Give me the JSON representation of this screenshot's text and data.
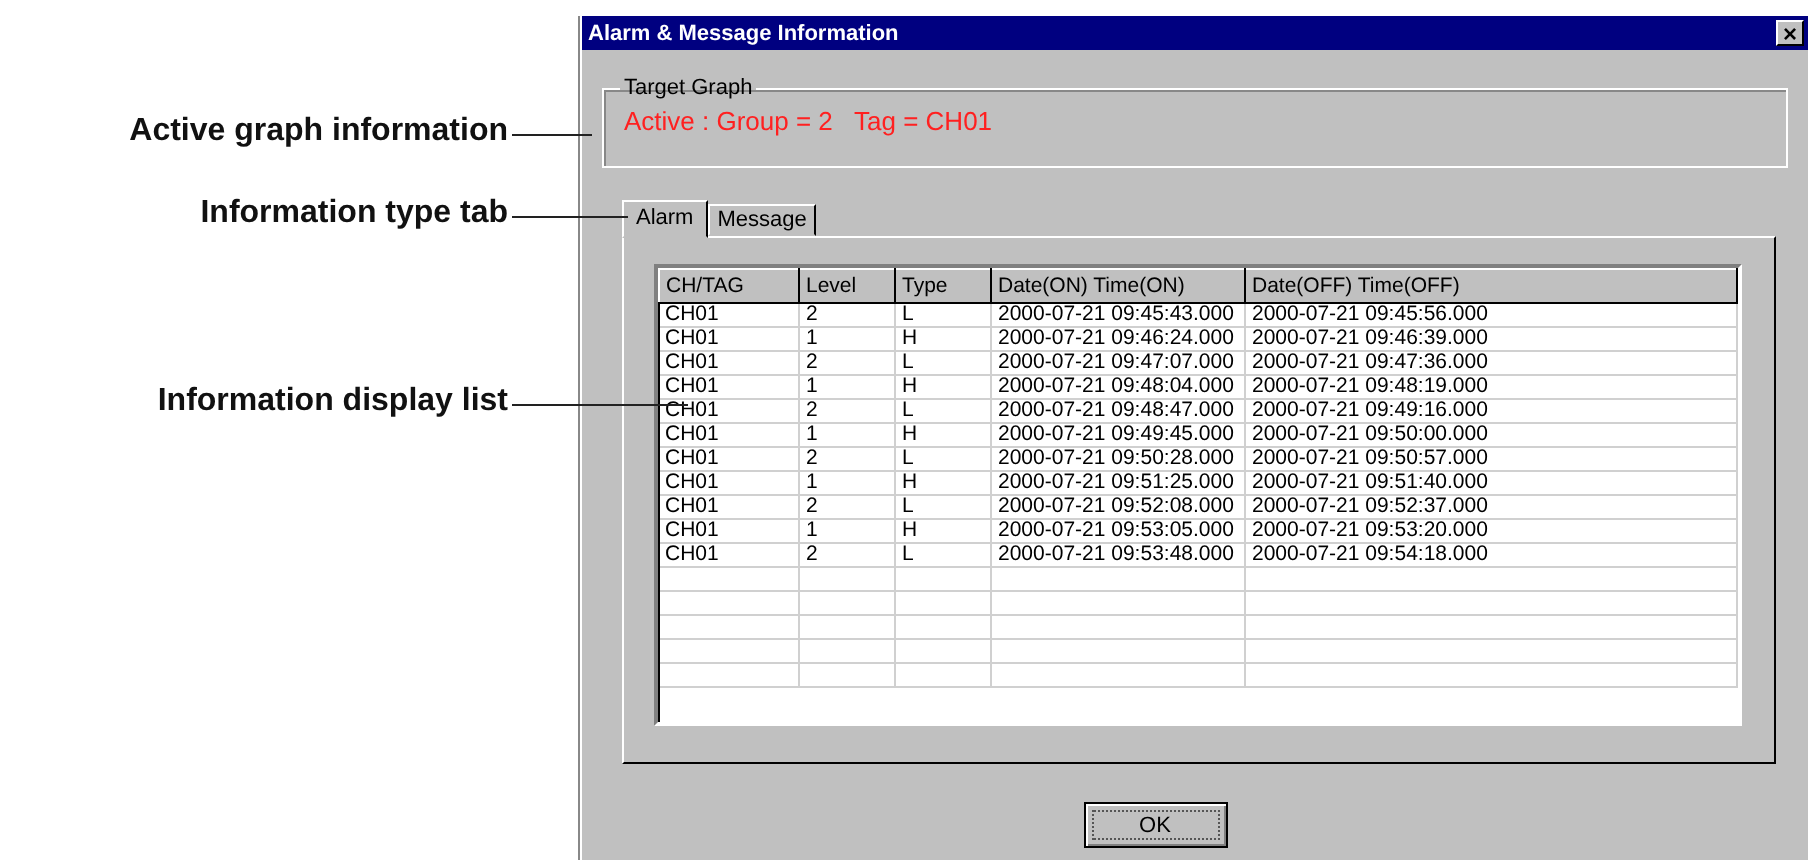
{
  "callouts": [
    {
      "label": "Active graph information"
    },
    {
      "label": "Information type tab"
    },
    {
      "label": "Information display list"
    }
  ],
  "window": {
    "title": "Alarm & Message Information",
    "close": "×"
  },
  "target_graph": {
    "legend": "Target Graph",
    "text": "Active : Group = 2   Tag = CH01"
  },
  "tabs": [
    {
      "label": "Alarm",
      "selected": true
    },
    {
      "label": "Message",
      "selected": false
    }
  ],
  "table": {
    "columns": [
      "CH/TAG",
      "Level",
      "Type",
      "Date(ON) Time(ON)",
      "Date(OFF) Time(OFF)"
    ],
    "rows": [
      [
        "CH01",
        "2",
        "L",
        "2000-07-21 09:45:43.000",
        "2000-07-21 09:45:56.000"
      ],
      [
        "CH01",
        "1",
        "H",
        "2000-07-21 09:46:24.000",
        "2000-07-21 09:46:39.000"
      ],
      [
        "CH01",
        "2",
        "L",
        "2000-07-21 09:47:07.000",
        "2000-07-21 09:47:36.000"
      ],
      [
        "CH01",
        "1",
        "H",
        "2000-07-21 09:48:04.000",
        "2000-07-21 09:48:19.000"
      ],
      [
        "CH01",
        "2",
        "L",
        "2000-07-21 09:48:47.000",
        "2000-07-21 09:49:16.000"
      ],
      [
        "CH01",
        "1",
        "H",
        "2000-07-21 09:49:45.000",
        "2000-07-21 09:50:00.000"
      ],
      [
        "CH01",
        "2",
        "L",
        "2000-07-21 09:50:28.000",
        "2000-07-21 09:50:57.000"
      ],
      [
        "CH01",
        "1",
        "H",
        "2000-07-21 09:51:25.000",
        "2000-07-21 09:51:40.000"
      ],
      [
        "CH01",
        "2",
        "L",
        "2000-07-21 09:52:08.000",
        "2000-07-21 09:52:37.000"
      ],
      [
        "CH01",
        "1",
        "H",
        "2000-07-21 09:53:05.000",
        "2000-07-21 09:53:20.000"
      ],
      [
        "CH01",
        "2",
        "L",
        "2000-07-21 09:53:48.000",
        "2000-07-21 09:54:18.000"
      ]
    ]
  },
  "buttons": [
    {
      "label": "OK"
    }
  ]
}
